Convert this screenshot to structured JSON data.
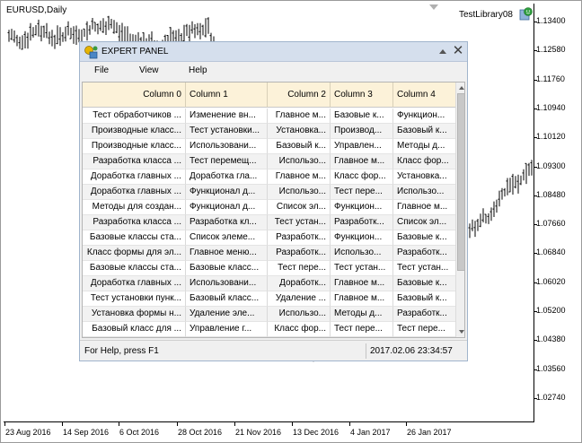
{
  "chart": {
    "symbol_title": "EURUSD,Daily",
    "expert_name": "TestLibrary08",
    "expert_icon": "smiley-expert-icon",
    "price_labels": [
      "1.13400",
      "1.12580",
      "1.11760",
      "1.10940",
      "1.10120",
      "1.09300",
      "1.08480",
      "1.07660",
      "1.06840",
      "1.06020",
      "1.05200",
      "1.04380",
      "1.03560",
      "1.02740"
    ],
    "date_labels": [
      "23 Aug 2016",
      "14 Sep 2016",
      "6 Oct 2016",
      "28 Oct 2016",
      "21 Nov 2016",
      "13 Dec 2016",
      "4 Jan 2017",
      "26 Jan 2017"
    ]
  },
  "panel": {
    "title": "EXPERT PANEL",
    "title_icon": "panel-app-icon",
    "menu": [
      "File",
      "View",
      "Help"
    ],
    "status_help": "For Help, press F1",
    "status_time": "2017.02.06 23:34:57",
    "colors": {
      "title_bg": "#d5dfed",
      "header_bg": "#fcf2d9",
      "row_alt_bg": "#f2f2f2"
    }
  },
  "table": {
    "headers": [
      "Column 0",
      "Column 1",
      "Column 2",
      "Column 3",
      "Column 4"
    ],
    "rows": [
      [
        "Тест обработчиков ...",
        "Изменение вн...",
        "Главное м...",
        "Базовые к...",
        "Функцион..."
      ],
      [
        "Производные класс...",
        "Тест установки...",
        "Установка...",
        "Производ...",
        "Базовый к..."
      ],
      [
        "Производные класс...",
        "Использовани...",
        "Базовый к...",
        "Управлен...",
        "Методы д..."
      ],
      [
        "Разработка класса ...",
        "Тест перемещ...",
        "Использо...",
        "Главное м...",
        "Класс фор..."
      ],
      [
        "Доработка главных ...",
        "Доработка гла...",
        "Главное м...",
        "Класс фор...",
        "Установка..."
      ],
      [
        "Доработка главных ...",
        "Функционал д...",
        "Использо...",
        "Тест пере...",
        "Использо..."
      ],
      [
        "Методы для создан...",
        "Функционал д...",
        "Список эл...",
        "Функцион...",
        "Главное м..."
      ],
      [
        "Разработка класса ...",
        "Разработка кл...",
        "Тест устан...",
        "Разработк...",
        "Список эл..."
      ],
      [
        "Базовые классы ста...",
        "Список элеме...",
        "Разработк...",
        "Функцион...",
        "Базовые к..."
      ],
      [
        "Класс формы для эл...",
        "Главное меню...",
        "Разработк...",
        "Использо...",
        "Разработк..."
      ],
      [
        "Базовые классы ста...",
        "Базовые класс...",
        "Тест пере...",
        "Тест устан...",
        "Тест устан..."
      ],
      [
        "Доработка главных ...",
        "Использовани...",
        "Доработк...",
        "Главное м...",
        "Базовые к..."
      ],
      [
        "Тест установки пунк...",
        "Базовый класс...",
        "Удаление ...",
        "Главное м...",
        "Базовый к..."
      ],
      [
        "Установка формы н...",
        "Удаление эле...",
        "Использо...",
        "Методы д...",
        "Разработк..."
      ],
      [
        "Базовый класс для ...",
        "Управление г...",
        "Класс фор...",
        "Тест пере...",
        "Тест пере..."
      ]
    ]
  }
}
